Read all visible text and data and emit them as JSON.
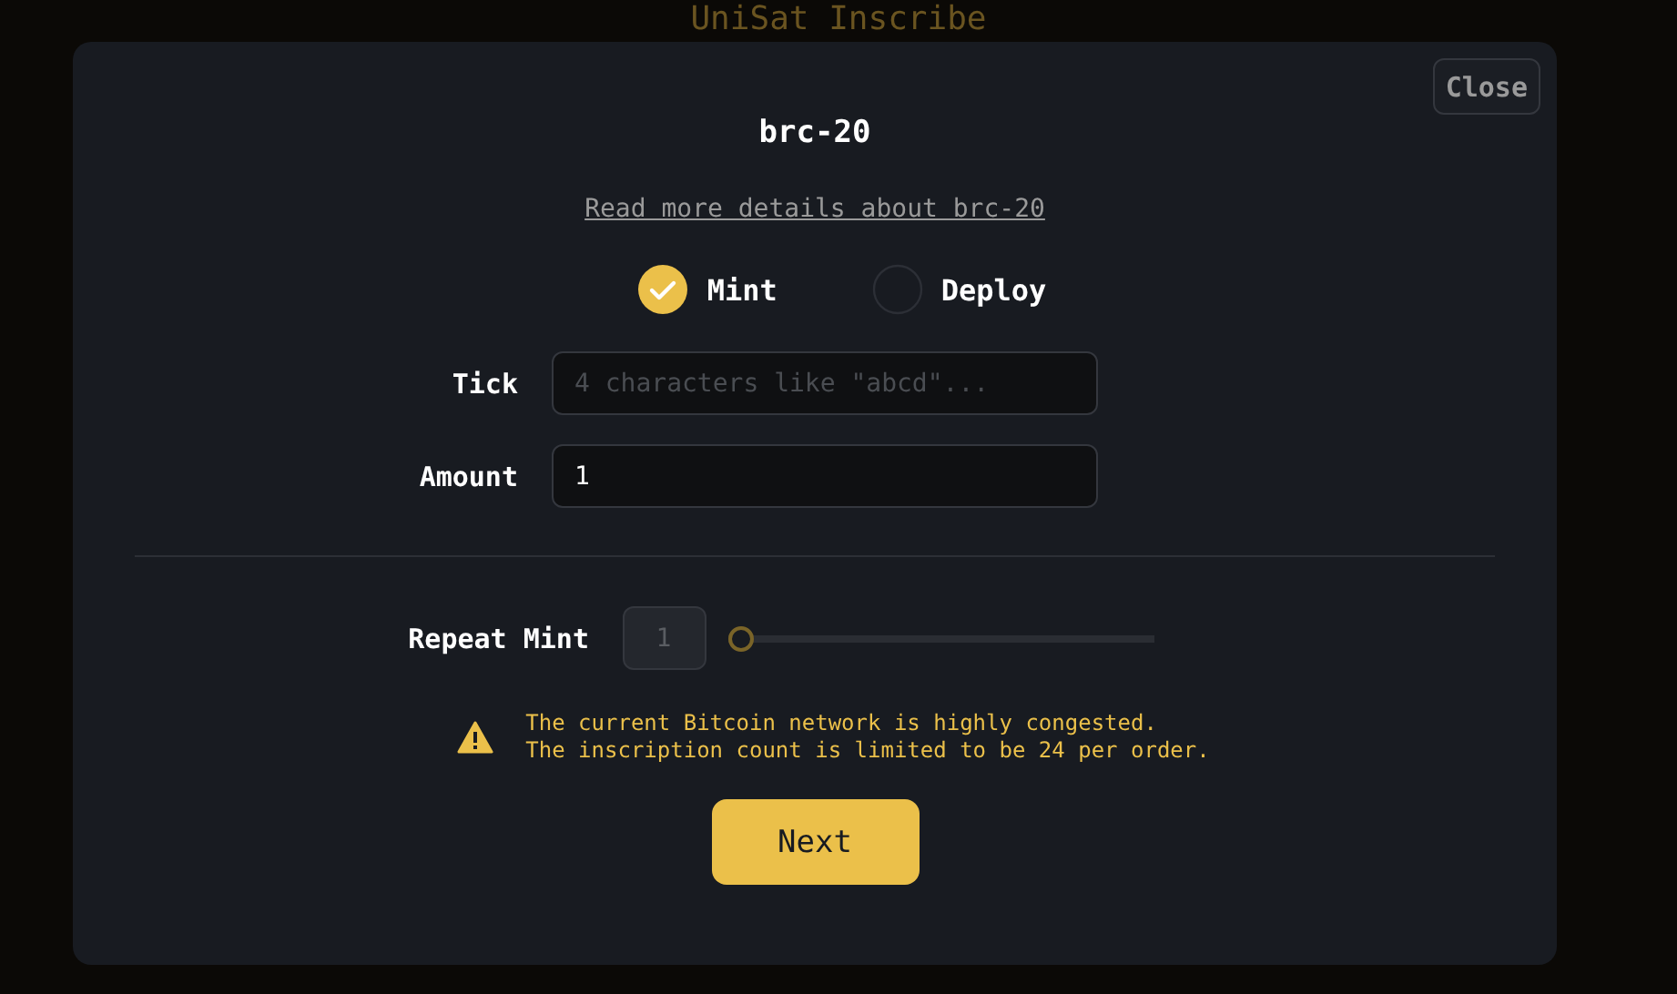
{
  "background": {
    "title": "UniSat Inscribe"
  },
  "dialog": {
    "close": "Close",
    "title": "brc-20",
    "details_link": "Read more details about brc-20",
    "options": [
      {
        "label": "Mint",
        "selected": true
      },
      {
        "label": "Deploy",
        "selected": false
      }
    ],
    "fields": [
      {
        "label": "Tick",
        "placeholder": "4 characters like \"abcd\"..."
      },
      {
        "label": "Amount",
        "value": "1"
      }
    ],
    "repeat": {
      "label": "Repeat Mint",
      "count": "1",
      "level": 0
    },
    "warning": [
      "The current Bitcoin network is highly congested.",
      "The inscription count is limited to be 24 per order."
    ],
    "next": "Next"
  }
}
